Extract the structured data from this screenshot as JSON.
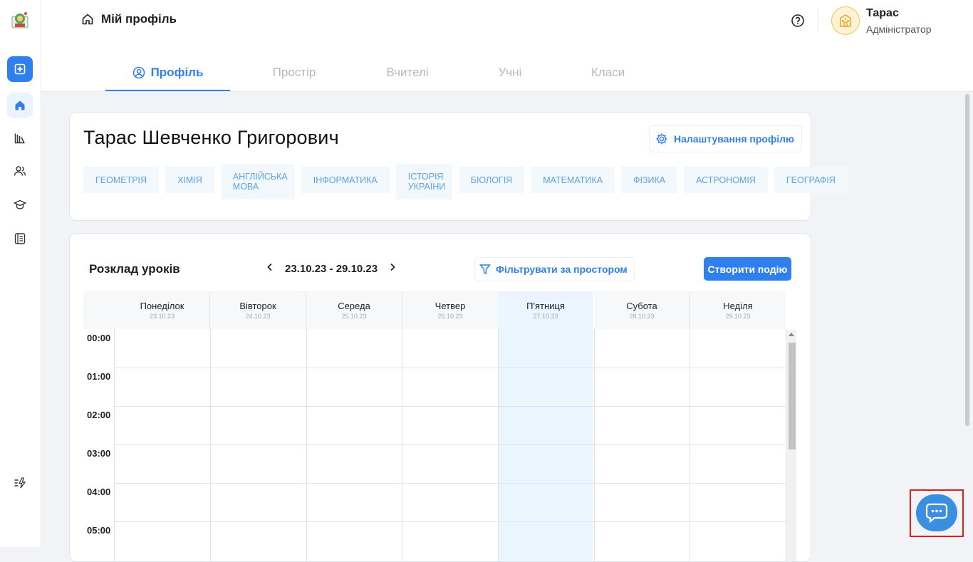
{
  "header": {
    "breadcrumb": "Мій профіль",
    "user_name": "Тарас",
    "user_role": "Адміністратор"
  },
  "tabs": [
    {
      "label": "Профіль",
      "active": true
    },
    {
      "label": "Простір",
      "active": false
    },
    {
      "label": "Вчителі",
      "active": false
    },
    {
      "label": "Учні",
      "active": false
    },
    {
      "label": "Класи",
      "active": false
    }
  ],
  "profile": {
    "full_name": "Тарас Шевченко Григорович",
    "settings_label": "Налаштування профілю",
    "subjects": [
      "ГЕОМЕТРІЯ",
      "ХІМІЯ",
      "АНГЛІЙСЬКА МОВА",
      "ІНФОРМАТИКА",
      "ІСТОРІЯ УКРАЇНИ",
      "БІОЛОГІЯ",
      "МАТЕМАТИКА",
      "ФІЗИКА",
      "АСТРОНОМІЯ",
      "ГЕОГРАФІЯ"
    ]
  },
  "schedule": {
    "title": "Розклад уроків",
    "week_range": "23.10.23 - 29.10.23",
    "filter_label": "Фільтрувати за простором",
    "create_label": "Створити подію",
    "days": [
      {
        "name": "Понеділок",
        "date": "23.10.23"
      },
      {
        "name": "Вівторок",
        "date": "24.10.23"
      },
      {
        "name": "Середа",
        "date": "25.10.23"
      },
      {
        "name": "Четвер",
        "date": "26.10.23"
      },
      {
        "name": "П'ятниця",
        "date": "27.10.23"
      },
      {
        "name": "Субота",
        "date": "28.10.23"
      },
      {
        "name": "Неділя",
        "date": "29.10.23"
      }
    ],
    "hours": [
      "00:00",
      "01:00",
      "02:00",
      "03:00",
      "04:00",
      "05:00"
    ]
  },
  "colors": {
    "accent": "#2f80ed",
    "today_column": "#eaf5ff",
    "chip_bg": "#f3f8fd",
    "chip_text": "#5aa3e6"
  },
  "icons": {
    "sidebar": [
      "add-icon",
      "home-icon",
      "library-icon",
      "users-icon",
      "graduation-cap-icon",
      "journal-icon",
      "flash-icon"
    ],
    "header": [
      "home-icon",
      "help-icon",
      "school-icon"
    ],
    "chat": "chat-bubble-icon"
  }
}
